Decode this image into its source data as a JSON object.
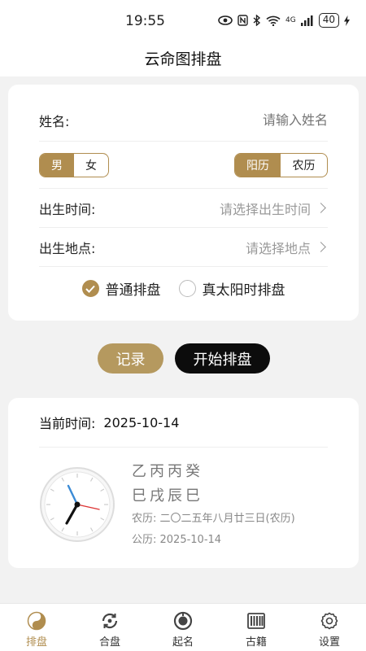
{
  "status_bar": {
    "time": "19:55",
    "network": "4G",
    "battery": "40"
  },
  "header": {
    "title": "云命图排盘"
  },
  "form": {
    "name_label": "姓名:",
    "name_placeholder": "请输入姓名",
    "gender": {
      "options": [
        "男",
        "女"
      ],
      "selected": "男"
    },
    "calendar": {
      "options": [
        "阳历",
        "农历"
      ],
      "selected": "阳历"
    },
    "birth_time_label": "出生时间:",
    "birth_time_placeholder": "请选择出生时间",
    "birth_place_label": "出生地点:",
    "birth_place_placeholder": "请选择地点",
    "modes": [
      {
        "label": "普通排盘",
        "checked": true
      },
      {
        "label": "真太阳时排盘",
        "checked": false
      }
    ]
  },
  "actions": {
    "record": "记录",
    "start": "开始排盘"
  },
  "current": {
    "label": "当前时间:",
    "date": "2025-10-14",
    "ganzhi_top": "乙丙丙癸",
    "ganzhi_bottom": "巳戌辰巳",
    "lunar": "农历: 二〇二五年八月廿三日(农历)",
    "solar": "公历: 2025-10-14"
  },
  "tabs": [
    {
      "label": "排盘",
      "icon": "yin-yang-icon",
      "active": true
    },
    {
      "label": "合盘",
      "icon": "sync-circle-icon",
      "active": false
    },
    {
      "label": "起名",
      "icon": "naming-icon",
      "active": false
    },
    {
      "label": "古籍",
      "icon": "book-icon",
      "active": false
    },
    {
      "label": "设置",
      "icon": "gear-icon",
      "active": false
    }
  ],
  "colors": {
    "accent": "#b08d4f",
    "primary_button": "#0c0c0c",
    "record_button": "#b5995f"
  }
}
